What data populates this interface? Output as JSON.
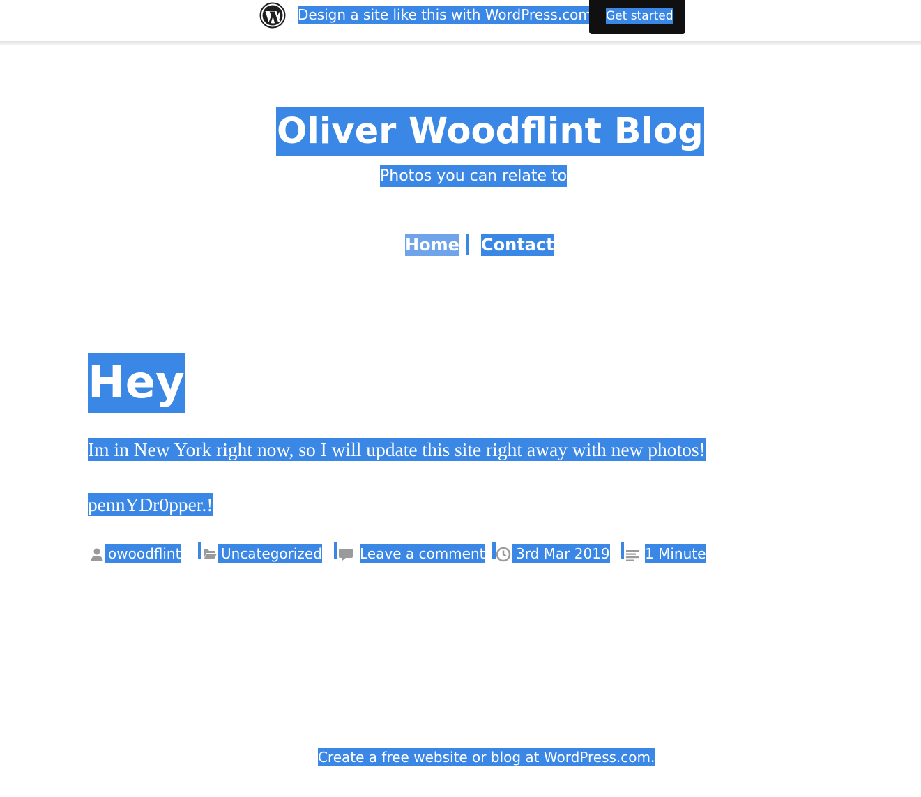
{
  "promo": {
    "text": "Design a site like this with WordPress.com",
    "button_label": "Get started"
  },
  "header": {
    "site_title": "Oliver Woodflint Blog",
    "tagline": "Photos you can relate to"
  },
  "nav": {
    "items": [
      {
        "label": "Home"
      },
      {
        "label": "Contact"
      }
    ]
  },
  "post": {
    "title": "Hey",
    "paragraphs": [
      "Im in New York right now, so I will update this site right away with new photos!",
      "pennYDr0pper.!"
    ],
    "meta": {
      "author": "owoodflint",
      "category": "Uncategorized",
      "comments": "Leave a comment",
      "date": "3rd Mar 2019",
      "reading_time": "1 Minute"
    }
  },
  "footer": {
    "credit": "Create a free website or blog at WordPress.com."
  },
  "colors": {
    "selection": "#3a87e6",
    "nav_active": "#6fa3ea",
    "promo_button_bg": "#101010",
    "meta_icon": "#9a9a9a"
  },
  "icons": [
    "wordpress-logo-icon",
    "user-icon",
    "folder-icon",
    "comment-icon",
    "clock-icon",
    "reading-time-icon"
  ]
}
